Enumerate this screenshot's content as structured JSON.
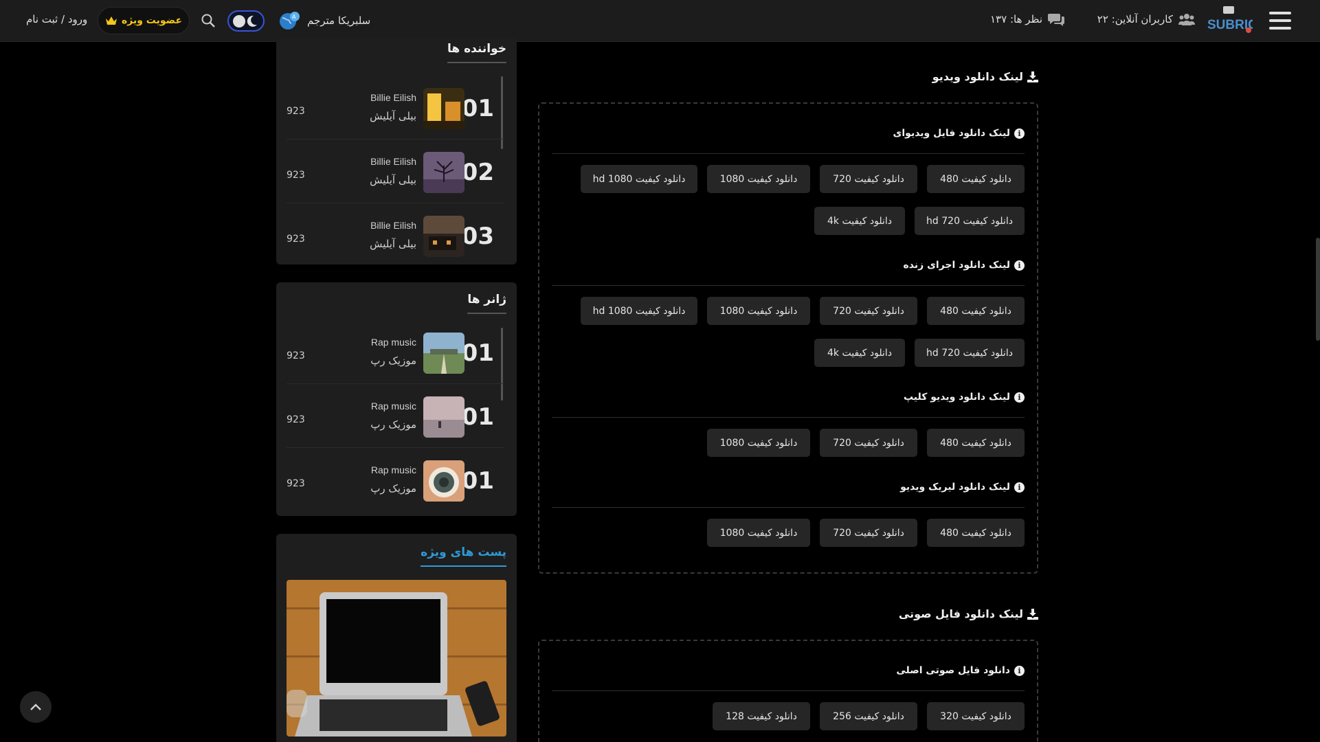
{
  "header": {
    "online_label": "کاربران آنلاین: ۲۲",
    "comments_label": "نظر ها: ۱۳۷",
    "translator_label": "سلبریکا مترجم",
    "vip_label": "عضویت ویژه",
    "login_label": "ورود / ثبت نام",
    "logo_text": "SUBRICA",
    "icons": [
      "menu-icon",
      "users-icon",
      "comments-icon",
      "globe-icon",
      "moon-icon",
      "search-icon",
      "crown-icon"
    ]
  },
  "singers": {
    "title": "خواننده ها",
    "items": [
      {
        "rank": "01",
        "name_en": "Billie Eilish",
        "name_fa": "بیلی آیلیش",
        "count": "923"
      },
      {
        "rank": "02",
        "name_en": "Billie Eilish",
        "name_fa": "بیلی آیلیش",
        "count": "923"
      },
      {
        "rank": "03",
        "name_en": "Billie Eilish",
        "name_fa": "بیلی آیلیش",
        "count": "923"
      }
    ]
  },
  "genres": {
    "title": "ژانر ها",
    "items": [
      {
        "rank": "01",
        "name_en": "Rap music",
        "name_fa": "موزیک رپ",
        "count": "923"
      },
      {
        "rank": "01",
        "name_en": "Rap music",
        "name_fa": "موزیک رپ",
        "count": "923"
      },
      {
        "rank": "01",
        "name_en": "Rap music",
        "name_fa": "موزیک رپ",
        "count": "923"
      }
    ]
  },
  "featured": {
    "title": "پست های ویژه"
  },
  "video_section": {
    "title": "لینک دانلود ویدیو",
    "groups": [
      {
        "title": "لینک دانلود فایل ویدیوای",
        "buttons": [
          "دانلود کیفیت 480",
          "دانلود کیفیت 720",
          "دانلود کیفیت 1080",
          "دانلود کیفیت 1080 hd",
          "دانلود کیفیت 720 hd",
          "دانلود کیفیت 4k"
        ]
      },
      {
        "title": "لینک دانلود اجرای زنده",
        "buttons": [
          "دانلود کیفیت 480",
          "دانلود کیفیت 720",
          "دانلود کیفیت 1080",
          "دانلود کیفیت 1080 hd",
          "دانلود کیفیت 720 hd",
          "دانلود کیفیت 4k"
        ]
      },
      {
        "title": "لینک دانلود ویدیو کلیپ",
        "buttons": [
          "دانلود کیفیت 480",
          "دانلود کیفیت 720",
          "دانلود کیفیت 1080"
        ]
      },
      {
        "title": "لینک دانلود لیریک ویدیو",
        "buttons": [
          "دانلود کیفیت 480",
          "دانلود کیفیت 720",
          "دانلود کیفیت 1080"
        ]
      }
    ]
  },
  "audio_section": {
    "title": "لینک دانلود فایل صوتی",
    "groups": [
      {
        "title": "دانلود فایل صوتی اصلی",
        "buttons": [
          "دانلود کیفیت 320",
          "دانلود کیفیت 256",
          "دانلود کیفیت 128"
        ]
      }
    ]
  },
  "colors": {
    "background": "#000000",
    "header": "#1c1c1c",
    "panel": "#1e1e1e",
    "button": "#262626",
    "accent_gold": "#f5c518",
    "accent_blue": "#2e9bd6"
  }
}
